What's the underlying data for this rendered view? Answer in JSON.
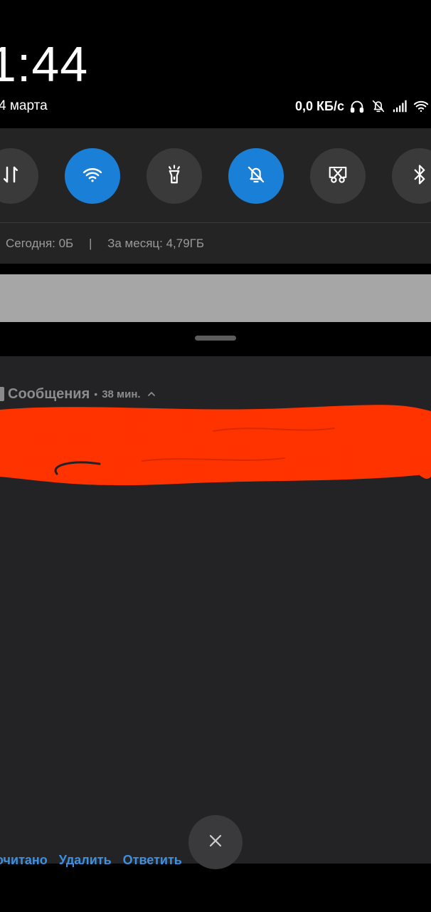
{
  "header": {
    "time": "1:44",
    "date": "4 марта",
    "net_speed": "0,0 КБ/с"
  },
  "quick_settings": {
    "tiles": [
      {
        "icon": "mobile-data-icon",
        "active": false
      },
      {
        "icon": "wifi-icon",
        "active": true
      },
      {
        "icon": "flashlight-icon",
        "active": false
      },
      {
        "icon": "silent-bell-icon",
        "active": true
      },
      {
        "icon": "screenshot-icon",
        "active": false
      },
      {
        "icon": "bluetooth-icon",
        "active": false
      }
    ],
    "data_usage_today": "Сегодня: 0Б",
    "separator": "|",
    "data_usage_month": "За месяц: 4,79ГБ"
  },
  "notification": {
    "app_name": "Сообщения",
    "dot": "•",
    "time": "38 мин.",
    "actions": {
      "mark_read": "очитано",
      "delete": "Удалить",
      "reply": "Ответить"
    }
  },
  "colors": {
    "accent_blue": "#1a7fd6",
    "action_blue": "#3d8fe0",
    "panel_bg": "#242424",
    "notif_bg": "#232325",
    "scribble_red": "#ff3300"
  }
}
